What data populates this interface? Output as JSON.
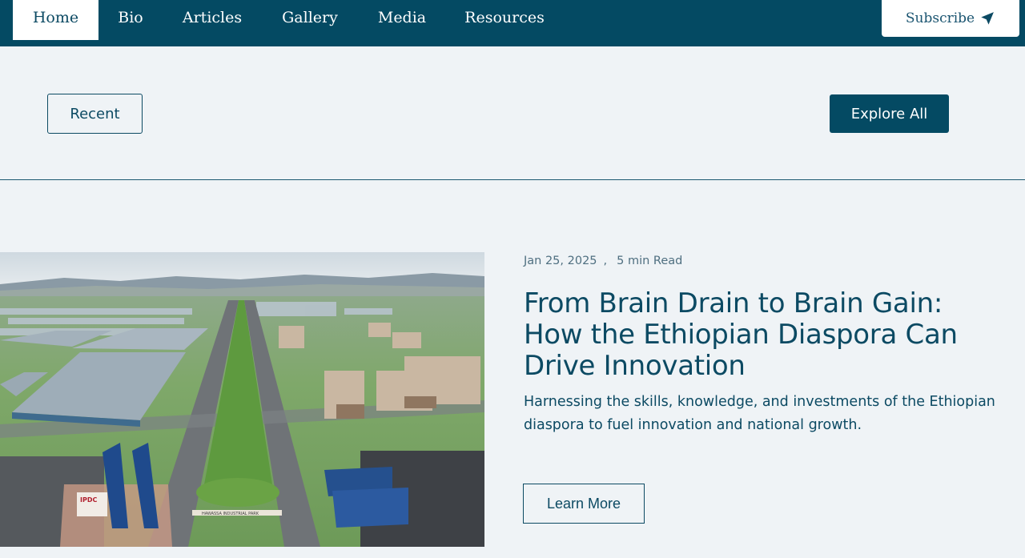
{
  "nav": {
    "items": [
      {
        "label": "Home",
        "active": true
      },
      {
        "label": "Bio"
      },
      {
        "label": "Articles"
      },
      {
        "label": "Gallery"
      },
      {
        "label": "Media"
      },
      {
        "label": "Resources"
      }
    ],
    "subscribe_label": "Subscribe",
    "subscribe_icon": "paper-plane-icon"
  },
  "filters": {
    "recent_label": "Recent",
    "explore_label": "Explore All"
  },
  "article": {
    "date": "Jan 25, 2025",
    "separator": ",",
    "read_time": "5 min Read",
    "title": "From Brain Drain to Brain Gain: How the Ethiopian Diaspora Can Drive Innovation",
    "excerpt": "Harnessing the skills, knowledge, and investments of the Ethiopian diaspora to fuel innovation and national growth.",
    "cta_label": "Learn More",
    "image_sign_text": "IPDC",
    "image_park_text": "HAWASSA INDUSTRIAL PARK"
  },
  "colors": {
    "primary": "#044a63",
    "background": "#eff3f6",
    "text": "#0c4a63",
    "muted": "#4f6f80"
  }
}
